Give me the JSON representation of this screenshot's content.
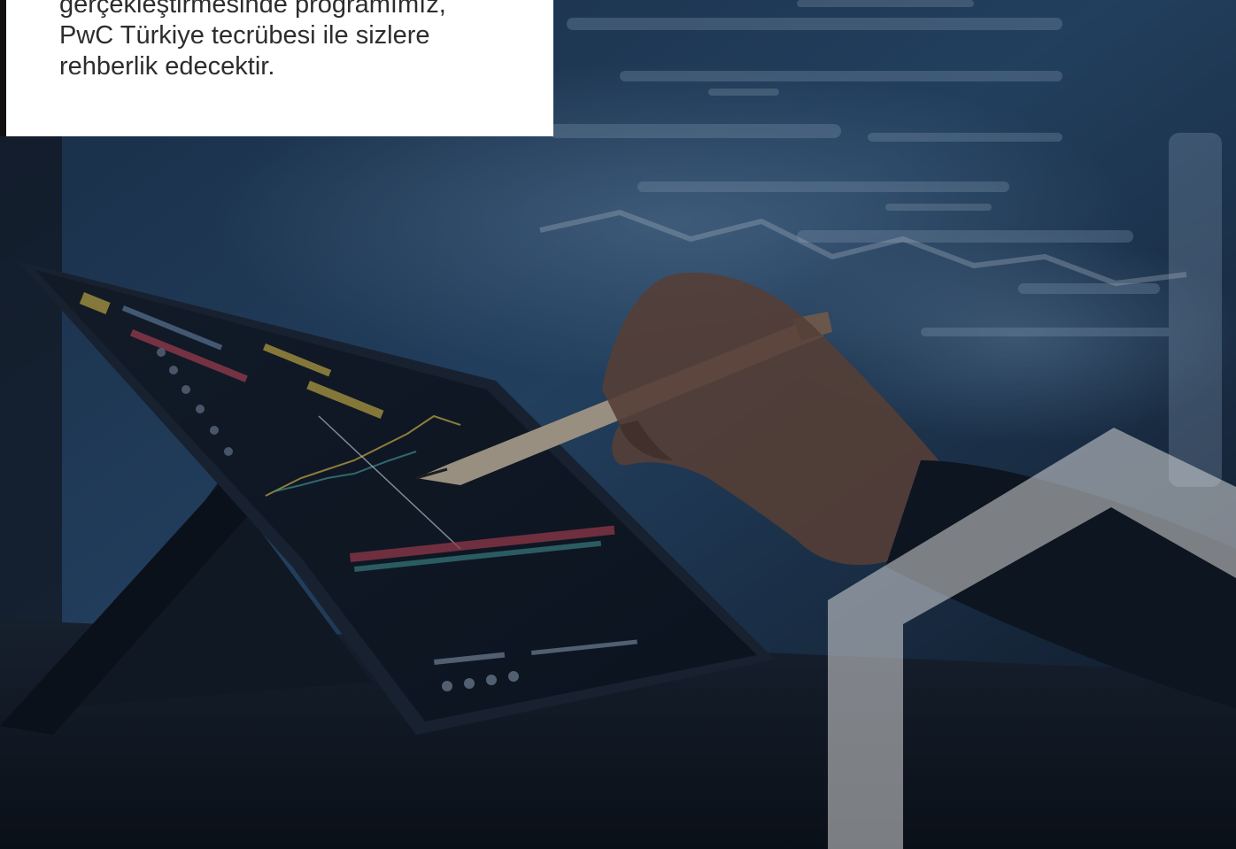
{
  "intro_card": {
    "lines": [
      "gerçekleştirmesinde programımız,",
      "PwC Türkiye tecrübesi ile sizlere",
      "rehberlik edecektir."
    ]
  },
  "colors": {
    "card_background": "#ffffff",
    "card_text": "#2d2d2d",
    "backdrop": "#0e1a2a",
    "hexagon_outline": "#d9d9d9"
  },
  "image": {
    "icon": "tablet-stock-chart-photo-icon"
  }
}
